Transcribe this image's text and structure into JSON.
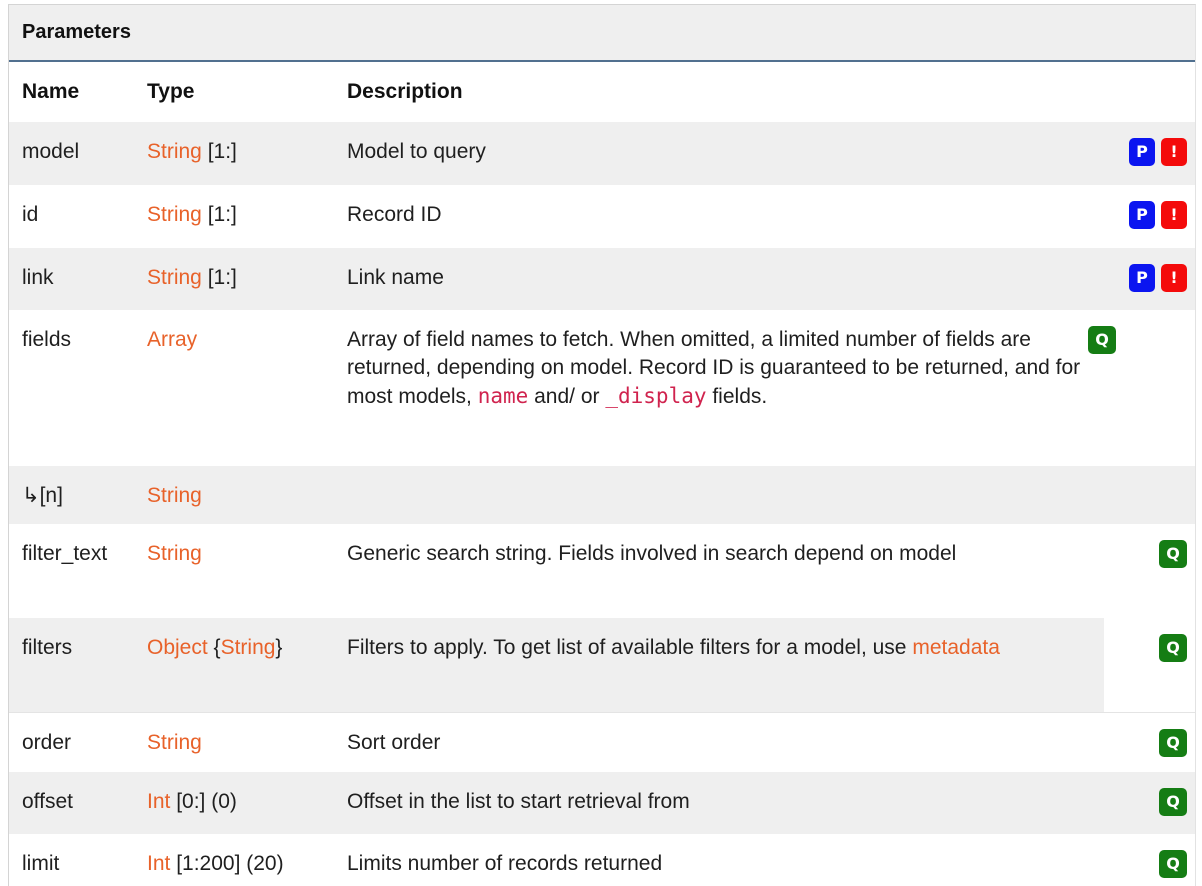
{
  "header": {
    "title": "Parameters"
  },
  "columns": {
    "name": "Name",
    "type": "Type",
    "description": "Description"
  },
  "rows": [
    {
      "name": "model",
      "type": "String",
      "type_suffix": " [1:]",
      "desc": "Model to query",
      "badges": [
        "P",
        "!"
      ]
    },
    {
      "name": "id",
      "type": "String",
      "type_suffix": " [1:]",
      "desc": "Record ID",
      "badges": [
        "P",
        "!"
      ]
    },
    {
      "name": "link",
      "type": "String",
      "type_suffix": " [1:]",
      "desc": "Link name",
      "badges": [
        "P",
        "!"
      ]
    },
    {
      "name": "fields",
      "type": "Array",
      "type_suffix": "",
      "desc_parts": {
        "a": "Array of field names to fetch. When omitted, a limited number of fields are returned, depending on model. Record ID is guaranteed to be returned, and for most models, ",
        "code1": "name",
        "b": " and/ or ",
        "code2": "_display",
        "c": " fields."
      },
      "badges": [
        "Q"
      ]
    },
    {
      "name": "↳[n]",
      "type": "String",
      "type_suffix": "",
      "desc": "",
      "badges": []
    },
    {
      "name": "filter_text",
      "type": "String",
      "type_suffix": "",
      "desc": "Generic search string. Fields involved in search depend on model",
      "badges": [
        "Q"
      ]
    },
    {
      "name": "filters",
      "type": "Object",
      "type_mid": " {",
      "type2": "String",
      "type_end": "}",
      "desc_parts": {
        "a": "Filters to apply. To get list of available filters for a model, use ",
        "link": "metadata"
      },
      "badges": [
        "Q"
      ]
    },
    {
      "name": "order",
      "type": "String",
      "type_suffix": "",
      "desc": "Sort order",
      "badges": [
        "Q"
      ]
    },
    {
      "name": "offset",
      "type": "Int",
      "type_suffix": " [0:] (0)",
      "desc": "Offset in the list to start retrieval from",
      "badges": [
        "Q"
      ]
    },
    {
      "name": "limit",
      "type": "Int",
      "type_suffix": " [1:200] (20)",
      "desc": "Limits number of records returned",
      "badges": [
        "Q"
      ]
    }
  ],
  "colors": {
    "type_link": "#e8622a",
    "code": "#d0234e",
    "badge_p": "#0b15f0",
    "badge_required": "#f40b0b",
    "badge_q": "#157d14",
    "header_rule": "#51708f"
  }
}
